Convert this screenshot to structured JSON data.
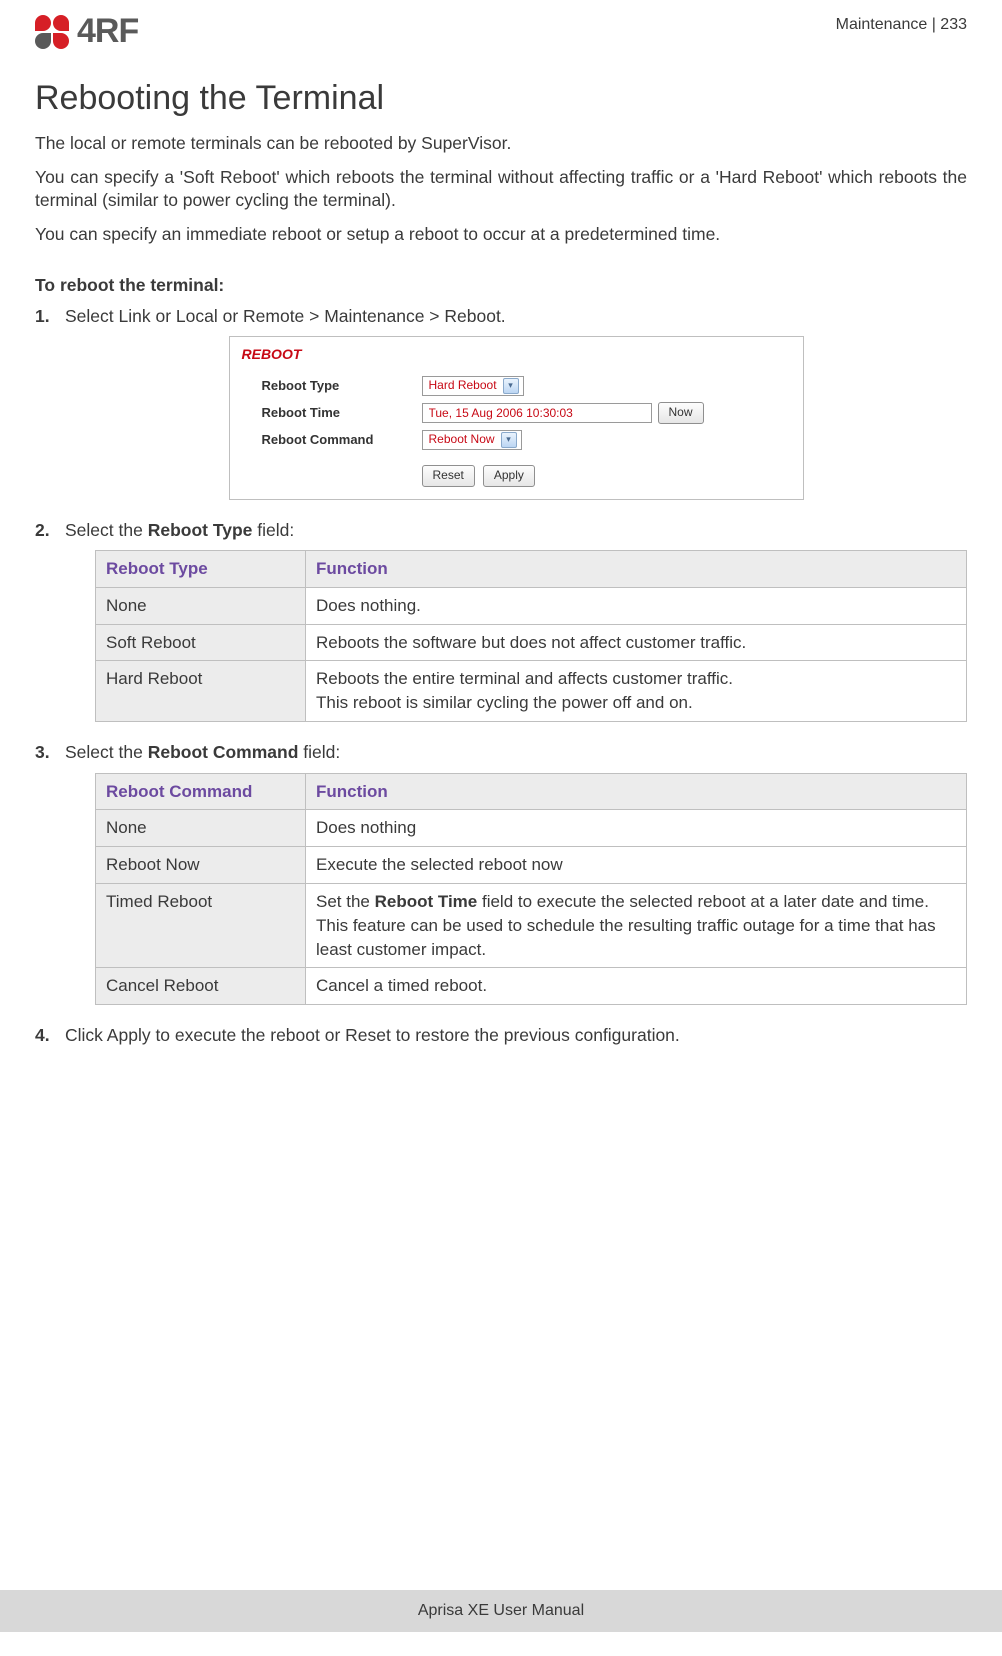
{
  "header": {
    "logo_text": "4RF",
    "section": "Maintenance",
    "separator": "  |  ",
    "page_number": "233"
  },
  "title": "Rebooting the Terminal",
  "paragraphs": {
    "p1": "The local or remote terminals can be rebooted by SuperVisor.",
    "p2": "You can specify a 'Soft Reboot' which reboots the terminal without affecting traffic or a 'Hard Reboot' which reboots the terminal (similar to power cycling the terminal).",
    "p3": "You can specify an immediate reboot or setup a reboot to occur at a predetermined time."
  },
  "subhead": "To reboot the terminal:",
  "steps": {
    "s1": "Select Link or Local or Remote > Maintenance > Reboot.",
    "s2_pre": "Select the ",
    "s2_b": "Reboot Type",
    "s2_post": " field:",
    "s3_pre": "Select the ",
    "s3_b": "Reboot Command",
    "s3_post": " field:",
    "s4": "Click Apply to execute the reboot or Reset to restore the previous configuration."
  },
  "screenshot": {
    "panel_title": "REBOOT",
    "labels": {
      "type": "Reboot Type",
      "time": "Reboot Time",
      "command": "Reboot Command"
    },
    "values": {
      "type": "Hard Reboot",
      "time": "Tue, 15 Aug 2006 10:30:03",
      "command": "Reboot Now"
    },
    "buttons": {
      "now": "Now",
      "reset": "Reset",
      "apply": "Apply"
    }
  },
  "table1": {
    "h1": "Reboot Type",
    "h2": "Function",
    "rows": [
      {
        "c1": "None",
        "c2": "Does nothing."
      },
      {
        "c1": "Soft Reboot",
        "c2": "Reboots the software but does not affect customer traffic."
      },
      {
        "c1": "Hard Reboot",
        "c2": "Reboots the entire terminal and affects customer traffic.\nThis reboot is similar cycling the power off and on."
      }
    ]
  },
  "table2": {
    "h1": "Reboot Command",
    "h2": "Function",
    "rows": [
      {
        "c1": "None",
        "c2": "Does nothing"
      },
      {
        "c1": "Reboot Now",
        "c2": "Execute the selected reboot now"
      },
      {
        "c1": "Timed Reboot",
        "c2_pre": "Set the ",
        "c2_b": "Reboot Time",
        "c2_post": " field to execute the selected reboot at a later date and time.\nThis feature can be used to schedule the resulting traffic outage for a time that has least customer impact."
      },
      {
        "c1": "Cancel Reboot",
        "c2": "Cancel a timed reboot."
      }
    ]
  },
  "footer": "Aprisa XE User Manual"
}
